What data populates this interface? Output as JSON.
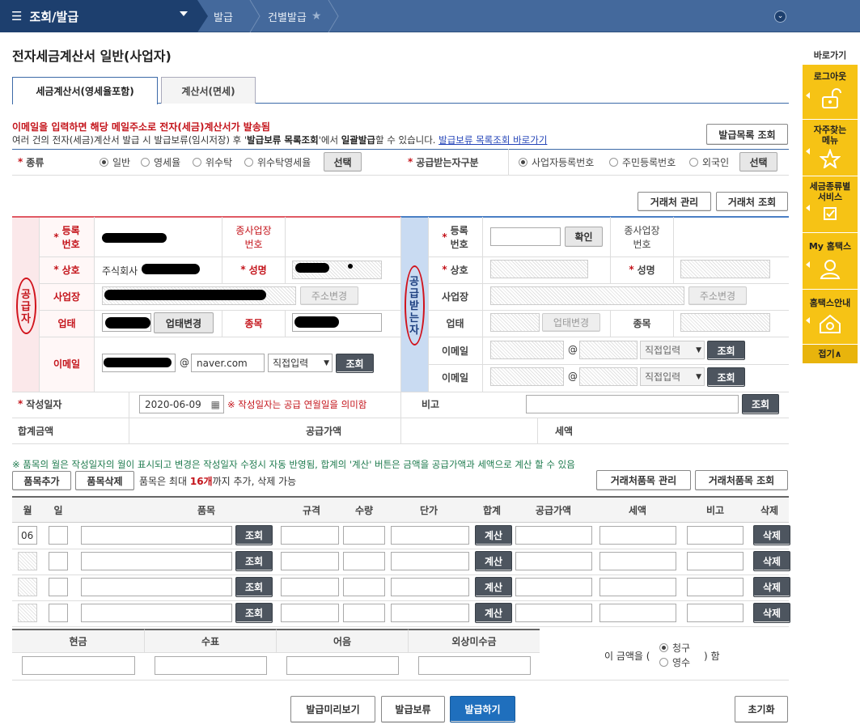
{
  "topbar": {
    "menu": "조회/발급",
    "crumbs": [
      "발급",
      "건별발급"
    ]
  },
  "page_title": "전자세금계산서 일반(사업자)",
  "tabs": [
    "세금계산서(영세율포함)",
    "계산서(면세)"
  ],
  "notice": {
    "line1": "이메일을 입력하면 해당 메일주소로 전자(세금)계산서가 발송됨",
    "line2_a": "여러 건의 전자(세금)계산서 발급 시 발급보류(임시저장) 후 '",
    "line2_b": "발급보류 목록조회",
    "line2_c": "'에서 ",
    "line2_d": "일괄발급",
    "line2_e": "할 수 있습니다. ",
    "line2_link": "발급보류 목록조회 바로가기"
  },
  "buttons": {
    "issue_list": "발급목록 조회",
    "select": "선택",
    "partner_manage": "거래처 관리",
    "partner_search": "거래처 조회",
    "confirm": "확인",
    "addr_change": "주소변경",
    "biz_change": "업태변경",
    "lookup": "조회",
    "item_add": "품목추가",
    "item_delete": "품목삭제",
    "partner_item_manage": "거래처품목 관리",
    "partner_item_search": "거래처품목 조회",
    "calc": "계산",
    "delete": "삭제",
    "preview": "발급미리보기",
    "hold": "발급보류",
    "issue": "발급하기",
    "reset": "초기화"
  },
  "kind": {
    "label": "종류",
    "options": [
      "일반",
      "영세율",
      "위수탁",
      "위수탁영세율"
    ],
    "selected": 0
  },
  "receiver_type": {
    "label": "공급받는자구분",
    "options": [
      "사업자등록번호",
      "주민등록번호",
      "외국인"
    ],
    "selected": 0
  },
  "supplier": {
    "side_label": "공급자",
    "reg_no_label": "등록\n번호",
    "branch_label": "종사업장\n번호",
    "name_label": "상호",
    "name_value": "주식회사",
    "ceo_label": "성명",
    "addr_label": "사업장",
    "biz_label": "업태",
    "item_label": "종목",
    "email_label": "이메일",
    "email_at": "@",
    "email_domain": "naver.com",
    "email_select": "직접입력"
  },
  "receiver": {
    "side_label": "공급받는자",
    "reg_no_label": "등록\n번호",
    "branch_label": "종사업장\n번호",
    "name_label": "상호",
    "ceo_label": "성명",
    "addr_label": "사업장",
    "biz_label": "업태",
    "item_label": "종목",
    "email_label": "이메일",
    "email_at": "@",
    "email_select": "직접입력"
  },
  "write_date": {
    "label": "작성일자",
    "value": "2020-06-09",
    "hint": "※ 작성일자는 공급 연월일을 의미함"
  },
  "remark_label": "비고",
  "totals": {
    "total_label": "합계금액",
    "supply_label": "공급가액",
    "tax_label": "세액"
  },
  "item_note": "※ 품목의 월은 작성일자의 월이 표시되고 변경은 작성일자 수정시 자동 반영됨, 합계의 '계산' 버튼은 금액을 공급가액과 세액으로 계산 할 수 있음",
  "item_limit": {
    "a": "품목은 최대 ",
    "b": "16개",
    "c": "까지 추가, 삭제 가능"
  },
  "items_table": {
    "headers": [
      "월",
      "일",
      "품목",
      "규격",
      "수량",
      "단가",
      "합계",
      "공급가액",
      "세액",
      "비고",
      "삭제"
    ],
    "first_month": "06"
  },
  "payment": {
    "headers": [
      "현금",
      "수표",
      "어음",
      "외상미수금"
    ],
    "amount_prefix": "이 금액을 (",
    "options": [
      "청구",
      "영수"
    ],
    "selected": 0,
    "amount_suffix": ") 함"
  },
  "sidebar": {
    "title": "바로가기",
    "items": [
      "로그아웃",
      "자주찾는\n메뉴",
      "세금종류별\n서비스",
      "My 홈택스",
      "홈택스안내"
    ],
    "fold": "접기∧"
  }
}
